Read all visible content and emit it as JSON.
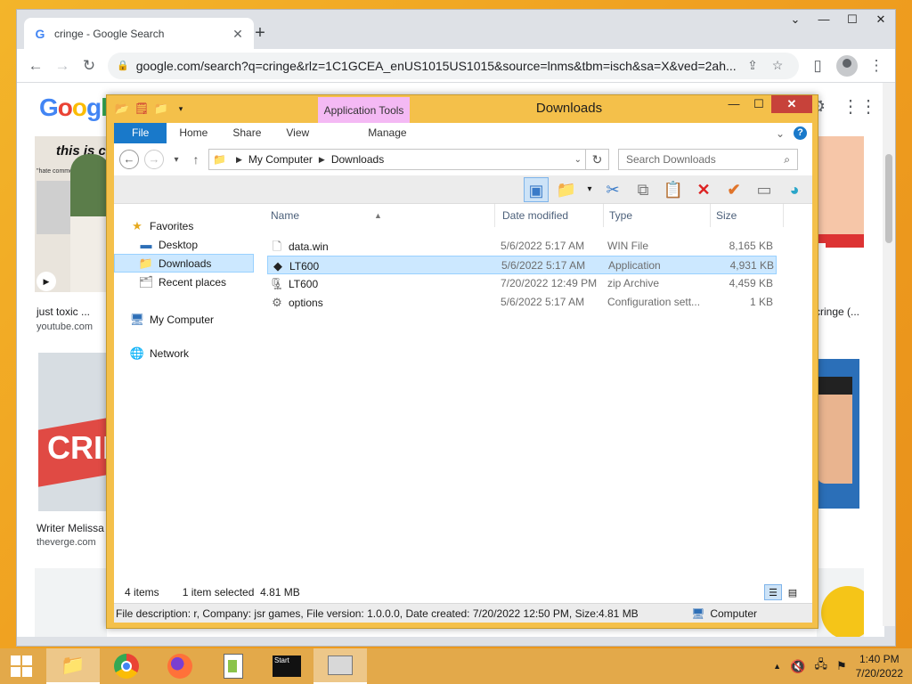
{
  "chrome": {
    "tab_title": "cringe - Google Search",
    "new_tab": "+",
    "url": "google.com/search?q=cringe&rlz=1C1GCEA_enUS1015US1015&source=lnms&tbm=isch&sa=X&ved=2ah..."
  },
  "google": {
    "logo": [
      "G",
      "o",
      "o",
      "g",
      "l"
    ],
    "results": [
      {
        "caption": "just toxic ...",
        "source": "youtube.com"
      },
      {
        "caption": "Writer Melissa",
        "source": "theverge.com"
      },
      {
        "caption": "cringe (...",
        "source": ""
      }
    ],
    "thumb_text_1": "this is c",
    "thumb_text_2": "CRIN",
    "thumb_comment": "\"hate comments!\""
  },
  "explorer": {
    "title": "Downloads",
    "context_tab": "Application Tools",
    "ribbon_tabs": {
      "file": "File",
      "home": "Home",
      "share": "Share",
      "view": "View",
      "manage": "Manage"
    },
    "address": {
      "root": "My Computer",
      "folder": "Downloads"
    },
    "search_placeholder": "Search Downloads",
    "nav": {
      "favorites": "Favorites",
      "desktop": "Desktop",
      "downloads": "Downloads",
      "recent": "Recent places",
      "computer": "My Computer",
      "network": "Network"
    },
    "columns": {
      "name": "Name",
      "date": "Date modified",
      "type": "Type",
      "size": "Size"
    },
    "files": [
      {
        "name": "data.win",
        "date": "5/6/2022 5:17 AM",
        "type": "WIN File",
        "size": "8,165 KB",
        "icon": "document-icon"
      },
      {
        "name": "LT600",
        "date": "5/6/2022 5:17 AM",
        "type": "Application",
        "size": "4,931 KB",
        "icon": "application-icon"
      },
      {
        "name": "LT600",
        "date": "7/20/2022 12:49 PM",
        "type": "zip Archive",
        "size": "4,459 KB",
        "icon": "zip-icon"
      },
      {
        "name": "options",
        "date": "5/6/2022 5:17 AM",
        "type": "Configuration sett...",
        "size": "1 KB",
        "icon": "settings-file-icon"
      }
    ],
    "status": {
      "count": "4 items",
      "selected": "1 item selected  4.81 MB"
    },
    "details": {
      "description": "File description: r, Company: jsr games, File version: 1.0.0.0, Date created: 7/20/2022 12:50 PM, Size: 4.81",
      "size": "4.81 MB",
      "location": "Computer"
    }
  },
  "taskbar": {
    "start_label": "Start",
    "time": "1:40 PM",
    "date": "7/20/2022"
  }
}
